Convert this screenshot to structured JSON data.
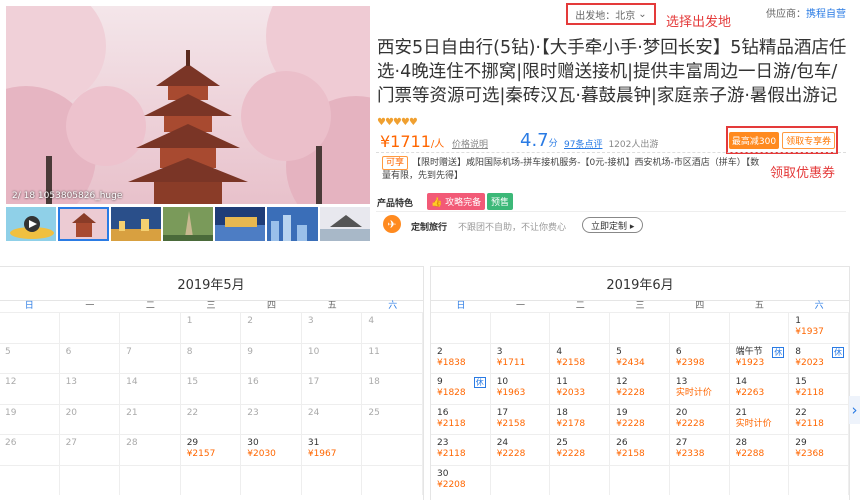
{
  "gallery": {
    "caption": "2/ 18 1053805826_huge",
    "play_icon": "play-icon"
  },
  "header": {
    "departure_label": "出发地：北京",
    "departure_note": "选择出发地",
    "supplier_label": "供应商：",
    "supplier_name": "携程自营"
  },
  "product": {
    "title": "西安5日自由行(5钻)·【大手牵小手·梦回长安】5钻精品酒店任选·4晚连住不挪窝|限时赠送接机|提供丰富周边一日游/包车/门票等资源可选|秦砖汉瓦·暮鼓晨钟|家庭亲子游·暑假出游记",
    "hearts": "♥♥♥♥♥",
    "price": "¥1711",
    "price_unit": "/人",
    "price_note": "价格说明",
    "score": "4.7",
    "score_unit": "分",
    "reviews": "97条点评",
    "sold": "1202人出游",
    "coupon_badge": "最高减300",
    "coupon_button": "领取专享券",
    "coupon_note": "领取优惠券",
    "enjoy_tag": "可享",
    "enjoy_text": "【限时赠送】咸阳国际机场-拼车接机服务-【0元-接机】西安机场-市区酒店（拼车）【数量有限，先到先得】",
    "features_label": "产品特色",
    "feature_1": "攻略完备",
    "feature_2": "预售",
    "custom_label": "定制旅行",
    "custom_desc": "不跟团不自助，不让你费心",
    "custom_button": "立即定制 ▸"
  },
  "cal_may": {
    "title": "2019年5月",
    "weekdays": [
      "日",
      "一",
      "二",
      "三",
      "四",
      "五",
      "六"
    ],
    "cells": [
      {
        "d": "",
        "p": ""
      },
      {
        "d": "",
        "p": ""
      },
      {
        "d": "",
        "p": ""
      },
      {
        "d": "1",
        "p": ""
      },
      {
        "d": "2",
        "p": ""
      },
      {
        "d": "3",
        "p": ""
      },
      {
        "d": "4",
        "p": ""
      },
      {
        "d": "5",
        "p": ""
      },
      {
        "d": "6",
        "p": ""
      },
      {
        "d": "7",
        "p": ""
      },
      {
        "d": "8",
        "p": ""
      },
      {
        "d": "9",
        "p": ""
      },
      {
        "d": "10",
        "p": ""
      },
      {
        "d": "11",
        "p": ""
      },
      {
        "d": "12",
        "p": ""
      },
      {
        "d": "13",
        "p": ""
      },
      {
        "d": "14",
        "p": ""
      },
      {
        "d": "15",
        "p": ""
      },
      {
        "d": "16",
        "p": ""
      },
      {
        "d": "17",
        "p": ""
      },
      {
        "d": "18",
        "p": ""
      },
      {
        "d": "19",
        "p": ""
      },
      {
        "d": "20",
        "p": ""
      },
      {
        "d": "21",
        "p": ""
      },
      {
        "d": "22",
        "p": ""
      },
      {
        "d": "23",
        "p": ""
      },
      {
        "d": "24",
        "p": ""
      },
      {
        "d": "25",
        "p": ""
      },
      {
        "d": "26",
        "p": ""
      },
      {
        "d": "27",
        "p": ""
      },
      {
        "d": "28",
        "p": ""
      },
      {
        "d": "29",
        "p": "¥2157"
      },
      {
        "d": "30",
        "p": "¥2030"
      },
      {
        "d": "31",
        "p": "¥1967"
      },
      {
        "d": "",
        "p": ""
      },
      {
        "d": "",
        "p": ""
      },
      {
        "d": "",
        "p": ""
      },
      {
        "d": "",
        "p": ""
      },
      {
        "d": "",
        "p": ""
      },
      {
        "d": "",
        "p": ""
      },
      {
        "d": "",
        "p": ""
      },
      {
        "d": "",
        "p": ""
      }
    ]
  },
  "cal_jun": {
    "title": "2019年6月",
    "weekdays": [
      "日",
      "一",
      "二",
      "三",
      "四",
      "五",
      "六"
    ],
    "cells": [
      {
        "d": "",
        "p": ""
      },
      {
        "d": "",
        "p": ""
      },
      {
        "d": "",
        "p": ""
      },
      {
        "d": "",
        "p": ""
      },
      {
        "d": "",
        "p": ""
      },
      {
        "d": "",
        "p": ""
      },
      {
        "d": "1",
        "p": "¥1937"
      },
      {
        "d": "2",
        "p": "¥1838"
      },
      {
        "d": "3",
        "p": "¥1711"
      },
      {
        "d": "4",
        "p": "¥2158"
      },
      {
        "d": "5",
        "p": "¥2434"
      },
      {
        "d": "6",
        "p": "¥2398"
      },
      {
        "d": "端午节",
        "p": "¥1923",
        "h": "休"
      },
      {
        "d": "8",
        "p": "¥2023",
        "h": "休"
      },
      {
        "d": "9",
        "p": "¥1828",
        "h": "休"
      },
      {
        "d": "10",
        "p": "¥1963"
      },
      {
        "d": "11",
        "p": "¥2033"
      },
      {
        "d": "12",
        "p": "¥2228"
      },
      {
        "d": "13",
        "p": "实时计价"
      },
      {
        "d": "14",
        "p": "¥2263"
      },
      {
        "d": "15",
        "p": "¥2118"
      },
      {
        "d": "16",
        "p": "¥2118"
      },
      {
        "d": "17",
        "p": "¥2158"
      },
      {
        "d": "18",
        "p": "¥2178"
      },
      {
        "d": "19",
        "p": "¥2228"
      },
      {
        "d": "20",
        "p": "¥2228"
      },
      {
        "d": "21",
        "p": "实时计价"
      },
      {
        "d": "22",
        "p": "¥2118"
      },
      {
        "d": "23",
        "p": "¥2118"
      },
      {
        "d": "24",
        "p": "¥2228"
      },
      {
        "d": "25",
        "p": "¥2228"
      },
      {
        "d": "26",
        "p": "¥2158"
      },
      {
        "d": "27",
        "p": "¥2338"
      },
      {
        "d": "28",
        "p": "¥2288"
      },
      {
        "d": "29",
        "p": "¥2368"
      },
      {
        "d": "30",
        "p": "¥2208"
      },
      {
        "d": "",
        "p": ""
      },
      {
        "d": "",
        "p": ""
      },
      {
        "d": "",
        "p": ""
      },
      {
        "d": "",
        "p": ""
      },
      {
        "d": "",
        "p": ""
      },
      {
        "d": "",
        "p": ""
      }
    ]
  }
}
